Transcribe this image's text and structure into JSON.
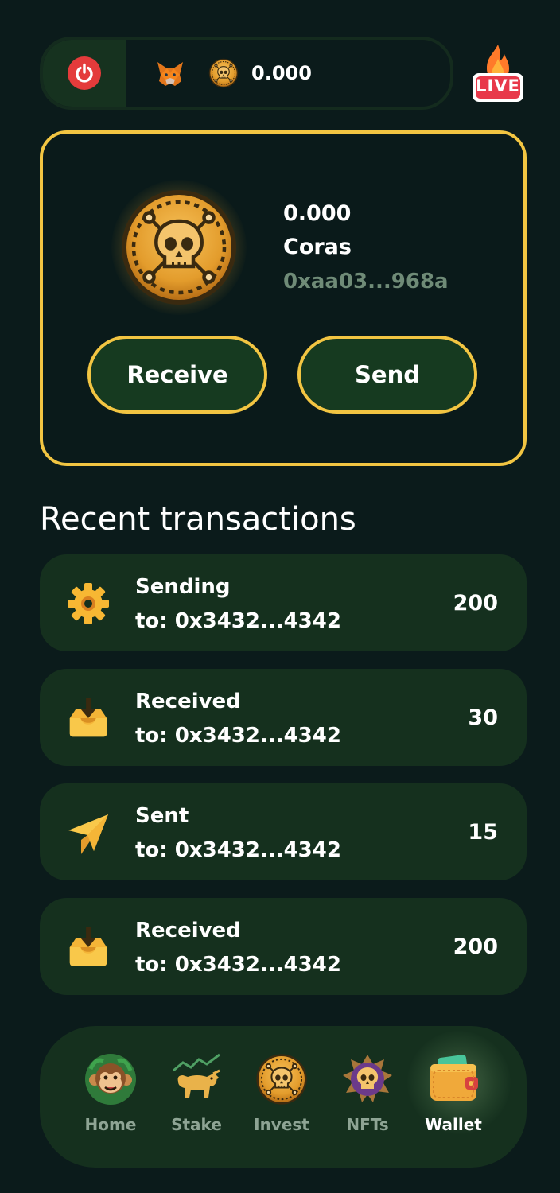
{
  "header": {
    "balance": "0.000",
    "live_label": "LIVE"
  },
  "card": {
    "amount": "0.000",
    "token_name": "Coras",
    "address": "0xaa03...968a",
    "receive_label": "Receive",
    "send_label": "Send"
  },
  "transactions": {
    "title": "Recent transactions",
    "items": [
      {
        "status": "Sending",
        "to": "to: 0x3432...4342",
        "amount": "200",
        "icon": "gear-icon"
      },
      {
        "status": "Received",
        "to": "to: 0x3432...4342",
        "amount": "30",
        "icon": "inbox-icon"
      },
      {
        "status": "Sent",
        "to": "to: 0x3432...4342",
        "amount": "15",
        "icon": "paper-plane-icon"
      },
      {
        "status": "Received",
        "to": "to: 0x3432...4342",
        "amount": "200",
        "icon": "inbox-icon"
      }
    ]
  },
  "nav": {
    "items": [
      {
        "label": "Home",
        "icon": "monkey-icon"
      },
      {
        "label": "Stake",
        "icon": "bull-chart-icon"
      },
      {
        "label": "Invest",
        "icon": "skull-coin-icon"
      },
      {
        "label": "NFTs",
        "icon": "skull-badge-icon"
      },
      {
        "label": "Wallet",
        "icon": "wallet-icon"
      }
    ],
    "active": "Wallet"
  },
  "colors": {
    "background": "#0b1b1b",
    "card_surface": "#15301e",
    "accent_gold": "#f2c542",
    "muted_text": "#8ea494",
    "power_red": "#e43b3b"
  }
}
